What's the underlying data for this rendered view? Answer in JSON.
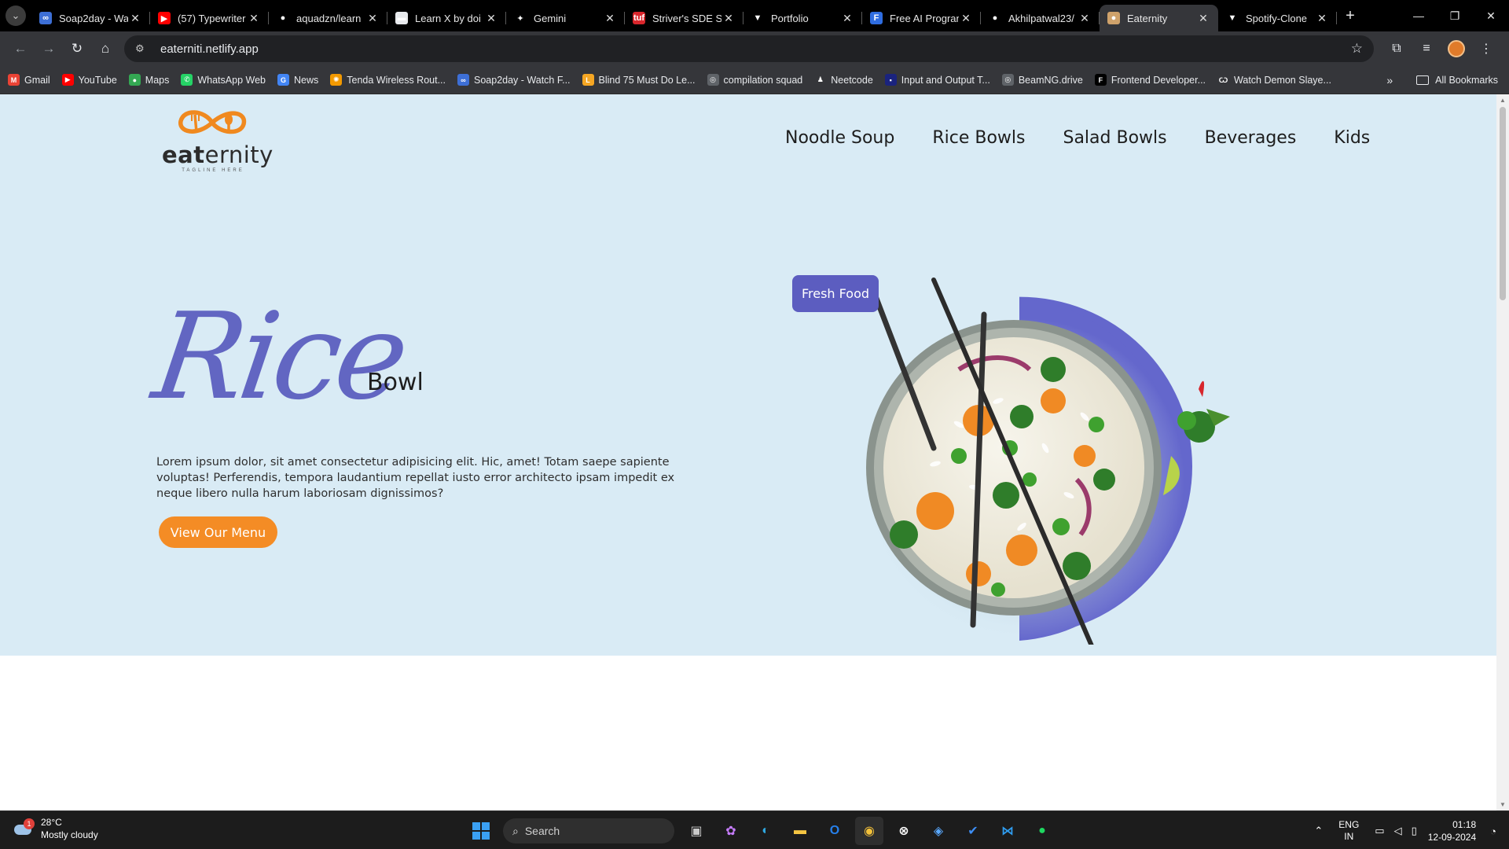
{
  "browser": {
    "tabs": [
      {
        "label": "Soap2day - Wa",
        "fav_color": "#3d6fd6",
        "fav_glyph": "∞"
      },
      {
        "label": "(57) Typewriter",
        "fav_color": "#ff0000",
        "fav_glyph": "▶"
      },
      {
        "label": "aquadzn/learn",
        "fav_color": "#000000",
        "fav_glyph": "●"
      },
      {
        "label": "Learn X by doi",
        "fav_color": "#e8eaed",
        "fav_glyph": "▬"
      },
      {
        "label": "Gemini",
        "fav_color": "#000000",
        "fav_glyph": "✦"
      },
      {
        "label": "Striver's SDE Sh",
        "fav_color": "#d9262c",
        "fav_glyph": "tuf"
      },
      {
        "label": "Portfolio",
        "fav_color": "#000000",
        "fav_glyph": "▼"
      },
      {
        "label": "Free AI Progran",
        "fav_color": "#2f6de1",
        "fav_glyph": "F"
      },
      {
        "label": "Akhilpatwal23/",
        "fav_color": "#000000",
        "fav_glyph": "●"
      },
      {
        "label": "Eaternity",
        "fav_color": "#cfa26b",
        "fav_glyph": "●"
      },
      {
        "label": "Spotify-Clone",
        "fav_color": "#000000",
        "fav_glyph": "▼"
      }
    ],
    "active_tab_index": 9,
    "url": "eaterniti.netlify.app",
    "bookmarks": [
      {
        "label": "Gmail",
        "color": "#ea4335",
        "glyph": "M"
      },
      {
        "label": "YouTube",
        "color": "#ff0000",
        "glyph": "▶"
      },
      {
        "label": "Maps",
        "color": "#34a853",
        "glyph": "●"
      },
      {
        "label": "WhatsApp Web",
        "color": "#25d366",
        "glyph": "✆"
      },
      {
        "label": "News",
        "color": "#4285f4",
        "glyph": "G"
      },
      {
        "label": "Tenda Wireless Rout...",
        "color": "#f29900",
        "glyph": "✺"
      },
      {
        "label": "Soap2day - Watch F...",
        "color": "#3d6fd6",
        "glyph": "∞"
      },
      {
        "label": "Blind 75 Must Do Le...",
        "color": "#f5a623",
        "glyph": "L"
      },
      {
        "label": "compilation squad",
        "color": "#5f6368",
        "glyph": "◎"
      },
      {
        "label": "Neetcode",
        "color": "#35363a",
        "glyph": "♟"
      },
      {
        "label": "Input and Output T...",
        "color": "#1a237e",
        "glyph": "▪"
      },
      {
        "label": "BeamNG.drive",
        "color": "#5f6368",
        "glyph": "◎"
      },
      {
        "label": "Frontend Developer...",
        "color": "#000000",
        "glyph": "F"
      },
      {
        "label": "Watch Demon Slaye...",
        "color": "#35363a",
        "glyph": "Ѡ"
      }
    ],
    "all_bookmarks_label": "All Bookmarks"
  },
  "site": {
    "logo_text_bold": "eat",
    "logo_text_rest": "ernity",
    "logo_tagline": "TAGLINE HERE",
    "nav": [
      "Noodle Soup",
      "Rice Bowls",
      "Salad Bowls",
      "Beverages",
      "Kids"
    ],
    "hero_script_word": "Rice",
    "hero_word": "Bowl",
    "description": "Lorem ipsum dolor, sit amet consectetur adipisicing elit. Hic, amet! Totam saepe sapiente voluptas! Perferendis, tempora laudantium repellat iusto error architecto ipsam impedit ex neque libero nulla harum laboriosam dignissimos?",
    "cta_label": "View Our Menu",
    "badge_label": "Fresh Food",
    "colors": {
      "hero_bg": "#d9ebf5",
      "accent_orange": "#f48c25",
      "accent_purple": "#5c5dc0"
    }
  },
  "taskbar": {
    "weather_temp": "28°C",
    "weather_desc": "Mostly cloudy",
    "weather_badge": "1",
    "search_placeholder": "Search",
    "lang_line1": "ENG",
    "lang_line2": "IN",
    "time": "01:18",
    "date": "12-09-2024"
  }
}
